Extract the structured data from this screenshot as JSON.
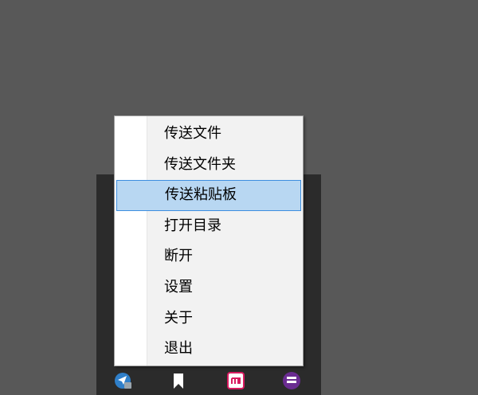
{
  "context_menu": {
    "items": [
      {
        "label": "传送文件",
        "highlighted": false
      },
      {
        "label": "传送文件夹",
        "highlighted": false
      },
      {
        "label": "传送粘贴板",
        "highlighted": true
      },
      {
        "label": "打开目录",
        "highlighted": false
      },
      {
        "label": "断开",
        "highlighted": false
      },
      {
        "label": "设置",
        "highlighted": false
      },
      {
        "label": "关于",
        "highlighted": false
      },
      {
        "label": "退出",
        "highlighted": false
      }
    ],
    "highlight_color": "#b8d7f2",
    "highlight_border_color": "#3d8ee0"
  },
  "tray": {
    "icons": [
      "transfer-app-icon",
      "bookmark-icon",
      "calendar-icon",
      "purple-app-icon"
    ],
    "colors": {
      "transfer": "#2f7fc9",
      "calendar": "#d81b60",
      "purple": "#6a2c91"
    }
  },
  "desktop_color": "#585858"
}
